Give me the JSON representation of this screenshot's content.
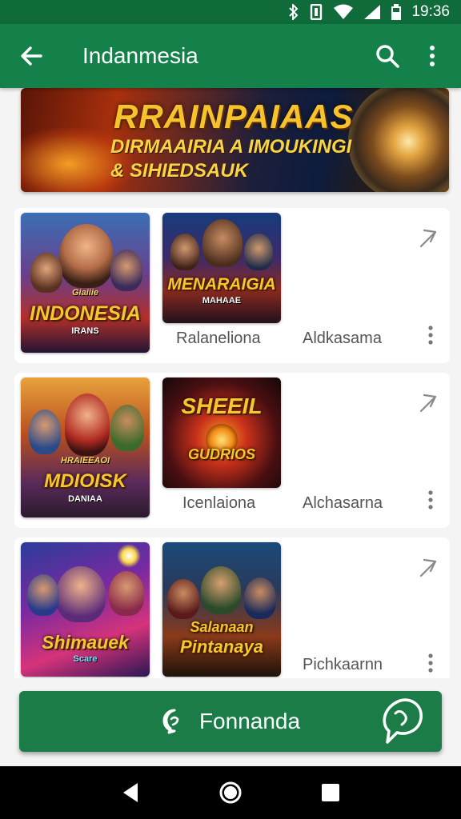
{
  "status_bar": {
    "time": "19:36",
    "icons": [
      "bluetooth-icon",
      "vibrate-icon",
      "wifi-icon",
      "signal-icon",
      "battery-icon"
    ]
  },
  "app_bar": {
    "title": "Indanmesia",
    "icons": [
      "back-arrow-icon",
      "search-icon",
      "more-vert-icon"
    ]
  },
  "banner": {
    "line1": "RRAINPAIAAS",
    "line2": "DIRMAAIRIA A IMOUKINGI",
    "line3": "& SIHIEDSAUK"
  },
  "rows": [
    {
      "games": [
        {
          "art_title": "INDONESIA",
          "art_top": "Giaiiie",
          "art_sub": "IRANS",
          "label": ""
        },
        {
          "art_title": "MENARAIGIA",
          "art_sub": "MAHAAE",
          "label": "Ralaneliona"
        }
      ],
      "side_label": "Aldkasama"
    },
    {
      "games": [
        {
          "art_title": "MDIOISK",
          "art_top": "HRAIEEAOI",
          "art_sub": "DANIAA",
          "label": ""
        },
        {
          "art_title": "SHEEIL",
          "art_sub": "GUDRIOS",
          "label": "Icenlaiona"
        }
      ],
      "side_label": "Alchasarna"
    },
    {
      "games": [
        {
          "art_title": "Shimauek",
          "art_sub": "Scare",
          "label": ""
        },
        {
          "art_title": "Pintanaya",
          "art_top": "Salanaan",
          "label": ""
        }
      ],
      "side_label": "Pichkaarnn"
    }
  ],
  "fab": {
    "label": "Fonnanda",
    "icon": "whatsapp-icon"
  },
  "nav": {
    "icons": [
      "nav-back-icon",
      "nav-home-icon",
      "nav-recents-icon"
    ]
  },
  "colors": {
    "app_bar": "#14804a",
    "status_bar": "#0f6b3a",
    "fab": "#1c7c47"
  }
}
